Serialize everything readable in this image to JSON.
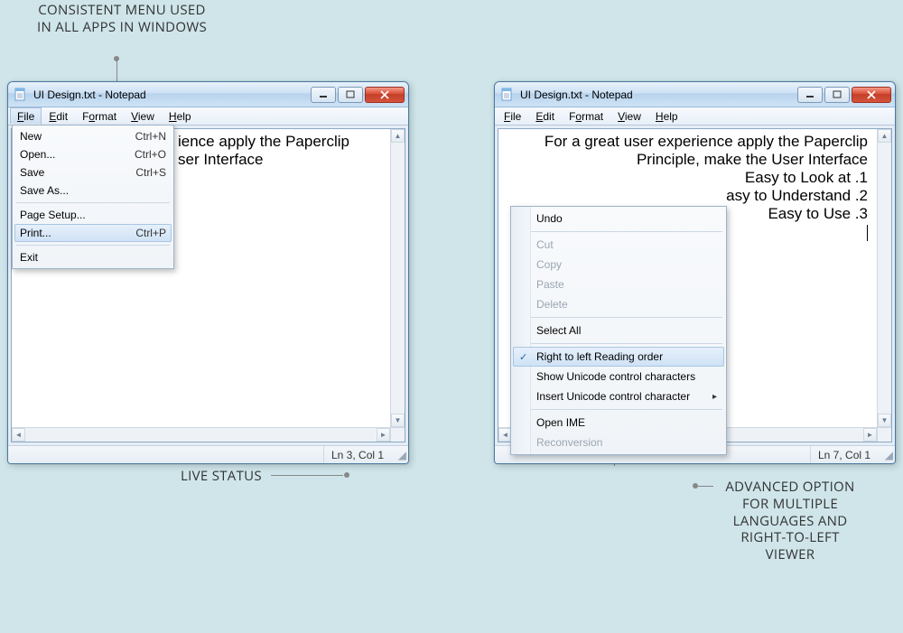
{
  "annotations": {
    "menu": "CONSISTENT MENU USED IN ALL APPS IN WINDOWS",
    "status": "LIVE STATUS",
    "rtl": "ADVANCED OPTION FOR MULTIPLE LANGUAGES AND RIGHT-TO-LEFT VIEWER"
  },
  "window_left": {
    "title": "UI Design.txt - Notepad",
    "menus": {
      "file": "File",
      "edit": "Edit",
      "format": "Format",
      "view": "View",
      "help": "Help"
    },
    "text": {
      "line1": "ience apply the Paperclip",
      "line2": "ser Interface"
    },
    "status": "Ln 3, Col 1",
    "file_menu": {
      "new": {
        "label": "New",
        "shortcut": "Ctrl+N"
      },
      "open": {
        "label": "Open...",
        "shortcut": "Ctrl+O"
      },
      "save": {
        "label": "Save",
        "shortcut": "Ctrl+S"
      },
      "save_as": {
        "label": "Save As...",
        "shortcut": ""
      },
      "page_setup": {
        "label": "Page Setup...",
        "shortcut": ""
      },
      "print": {
        "label": "Print...",
        "shortcut": "Ctrl+P"
      },
      "exit": {
        "label": "Exit",
        "shortcut": ""
      }
    }
  },
  "window_right": {
    "title": "UI Design.txt - Notepad",
    "menus": {
      "file": "File",
      "edit": "Edit",
      "format": "Format",
      "view": "View",
      "help": "Help"
    },
    "text": {
      "line1": "For a great user experience apply the Paperclip",
      "line2": "Principle, make the User Interface",
      "blank": "",
      "line4": "Easy to Look at .1",
      "line5": "asy to Understand .2",
      "line6": "Easy to Use .3"
    },
    "status": "Ln 7, Col 1",
    "context_menu": {
      "undo": "Undo",
      "cut": "Cut",
      "copy": "Copy",
      "paste": "Paste",
      "delete": "Delete",
      "select_all": "Select All",
      "rtl": "Right to left Reading order",
      "show_unicode": "Show Unicode control characters",
      "insert_unicode": "Insert Unicode control character",
      "open_ime": "Open IME",
      "reconversion": "Reconversion"
    }
  }
}
